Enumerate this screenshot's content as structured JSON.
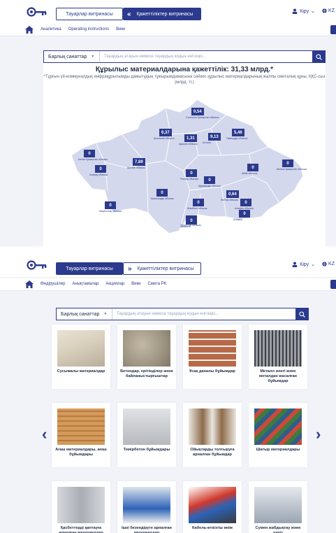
{
  "header": {
    "goods_tab": "Тауарлар витринасы",
    "needs_tab": "Қажеттіліктер витринасы",
    "login": "Кіру",
    "lang": "KZ"
  },
  "nav1": [
    "Аналитика",
    "Operating instructions",
    "Вики"
  ],
  "nav2": [
    "Өндірушілер",
    "Анықтамалар",
    "Акциялар",
    "Вики",
    "Смета РК"
  ],
  "search": {
    "category": "Барлық санаттар",
    "placeholder": "Тауардың атауын немесе тауардың кодын енгізіңіз..."
  },
  "map": {
    "title": "Құрылыс материалдарына қажеттілік: 31,33 млрд.*",
    "subtitle": "*Тұрғын үй-коммуналдық инфрақұрылымды дамытудың тұжырымдамасына сәйкес құрылыс материалдарының жалпы сметалық құны, ҚҚС-сыз (млрд. тг.)",
    "regions": [
      {
        "value": "0,54",
        "name": "Солтүстік Қазақстан облысы"
      },
      {
        "value": "6,37",
        "name": "Қостанай облысы"
      },
      {
        "value": "1,31",
        "name": "Ақмола облысы"
      },
      {
        "value": "9,13",
        "name": "Астана"
      },
      {
        "value": "5,46",
        "name": "Павлодар облысы"
      },
      {
        "value": "0",
        "name": "Батыс Қазақстан облысы"
      },
      {
        "value": "0",
        "name": "Атырау облысы"
      },
      {
        "value": "7,89",
        "name": "Ақтөбе облысы"
      },
      {
        "value": "0",
        "name": "Ұлытау облысы"
      },
      {
        "value": "0",
        "name": "Қарағанды облысы"
      },
      {
        "value": "0",
        "name": "Абай облысы"
      },
      {
        "value": "0",
        "name": "Шығыс Қазақстан облысы"
      },
      {
        "value": "0",
        "name": "Маңғыстау облысы"
      },
      {
        "value": "0",
        "name": "Қызылорда облысы"
      },
      {
        "value": "0,64",
        "name": "Жетісу облысы"
      },
      {
        "value": "0",
        "name": "Алматы облысы"
      },
      {
        "value": "0",
        "name": "Алматы"
      },
      {
        "value": "0",
        "name": "Жамбыл облысы"
      },
      {
        "value": "0",
        "name": "Түркістан облысы"
      },
      {
        "value": "0",
        "name": "Шымкент"
      }
    ]
  },
  "categories": [
    "Сусымалы материалдар",
    "Бетондар, ерітінділер және байланыстырғыштар",
    "Ұсақ даналы бұйымдар",
    "Металл илегі және металдан жасалған бұйымдар",
    "Ағаш материалдары, ағаш бұйымдары",
    "Темірбетон бұйымдары",
    "Ойықтарды толтыруға арналған бұйымдар",
    "Шатыр материалдары",
    "Қасбеттерді қаптауға арналған материалдар",
    "Ішкі безендіруге арналған материалдар",
    "Кабель-өткізгіш өнім",
    "Сумен жабдықтау және кәріз"
  ],
  "colors": {
    "primary": "#2b3a8c",
    "map_fill": "#d4d8ec",
    "map_stroke": "#ffffff"
  },
  "icons": [
    "key-logo-icon",
    "user-icon",
    "globe-icon",
    "home-icon",
    "cart-icon",
    "search-icon",
    "chevron-left-icon",
    "chevron-right-icon"
  ]
}
